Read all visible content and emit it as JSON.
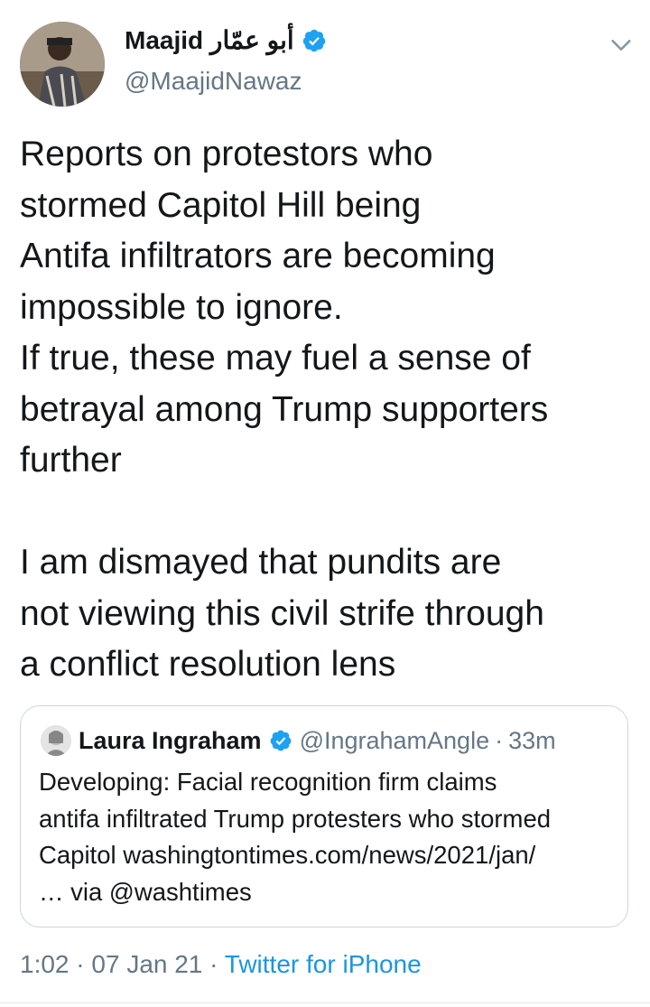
{
  "author": {
    "display_name": "Maajid أبو عمّار",
    "handle": "@MaajidNawaz",
    "verified": true
  },
  "tweet": {
    "text": "Reports on protestors who\nstormed Capitol Hill being\nAntifa infiltrators are becoming\nimpossible to ignore.\nIf true, these may fuel a sense of\nbetrayal among Trump supporters\nfurther\n\nI am dismayed that pundits are\nnot viewing this civil strife through\na conflict resolution lens"
  },
  "quoted_tweet": {
    "display_name": "Laura Ingraham",
    "handle": "@IngrahamAngle",
    "separator": "·",
    "time": "33m",
    "verified": true,
    "text": "Developing: Facial recognition firm claims\nantifa infiltrated Trump protesters who stormed\nCapitol washingtontimes.com/news/2021/jan/\n… via @washtimes"
  },
  "footer": {
    "time": "1:02",
    "separator": "·",
    "date": "07 Jan 21",
    "source": "Twitter for iPhone"
  },
  "icons": {
    "verified": "verified-badge-icon",
    "menu": "chevron-down-icon"
  },
  "colors": {
    "accent": "#1da1f2",
    "link": "#1b95e0",
    "secondary_text": "#657786",
    "border": "#ccd6dd"
  }
}
